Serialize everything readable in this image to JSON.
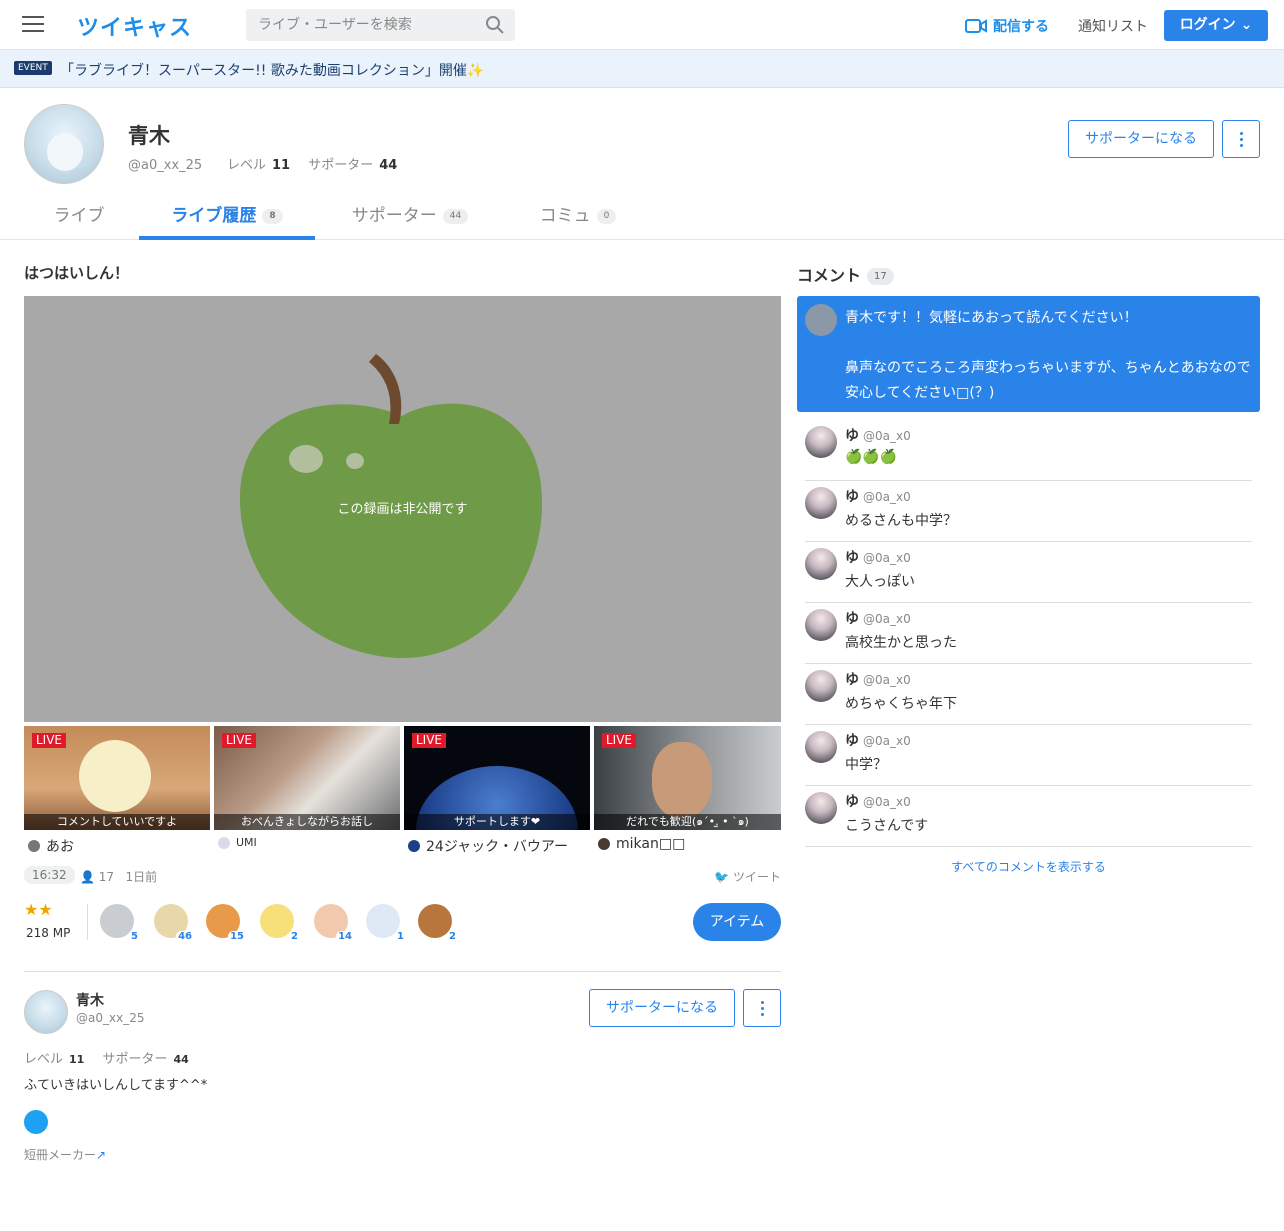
{
  "header": {
    "logo": "ツイキャス",
    "search_placeholder": "ライブ・ユーザーを検索",
    "broadcast": "配信する",
    "notifications": "通知リスト",
    "login": "ログイン"
  },
  "event": {
    "tag": "EVENT",
    "text": "「ラブライブ！スーパースター!! 歌みた動画コレクション」開催✨"
  },
  "profile": {
    "name": "青木",
    "id": "@a0_xx_25",
    "level_label": "レベル",
    "level": "11",
    "supporters_label": "サポーター",
    "supporters": "44",
    "support_button": "サポーターになる"
  },
  "tabs": [
    {
      "label": "ライブ",
      "count": ""
    },
    {
      "label": "ライブ履歴",
      "count": "8"
    },
    {
      "label": "サポーター",
      "count": "44"
    },
    {
      "label": "コミュ",
      "count": "0"
    }
  ],
  "video": {
    "title": "はつはいしん！",
    "private_msg": "この録画は非公開です",
    "duration": "16:32",
    "views": "17",
    "ago": "1日前",
    "tweet": "ツイート"
  },
  "thumbnails": [
    {
      "live": "LIVE",
      "caption": "コメントしていいですよ",
      "user": "あお"
    },
    {
      "live": "LIVE",
      "caption": "おべんきょしながらお話し",
      "user": "UMI"
    },
    {
      "live": "LIVE",
      "caption": "サポートします❤",
      "user": "24ジャック・バウアー"
    },
    {
      "live": "LIVE",
      "caption": "だれでも歓迎(๑´•.̫ • `๑)",
      "user": "mikan□□"
    }
  ],
  "items": {
    "stars": "★★",
    "mp": "218 MP",
    "gifts": [
      "5",
      "46",
      "15",
      "2",
      "14",
      "1",
      "2"
    ],
    "button": "アイテム"
  },
  "bio": {
    "name": "青木",
    "id": "@a0_xx_25",
    "level_label": "レベル",
    "level": "11",
    "supporters_label": "サポーター",
    "supporters": "44",
    "support_button": "サポーターになる",
    "description": "ふていきはいしんしてます^^*",
    "tanzaku": "短冊メーカー"
  },
  "comments": {
    "title": "コメント",
    "count": "17",
    "pinned_line1": "青木です！！気軽にあおって読んでください！",
    "pinned_line2": "鼻声なのでころころ声変わっちゃいますが、ちゃんとあおなので安心してください□(？)",
    "list": [
      {
        "name": "ゆ",
        "id": "@0a_x0",
        "text": "🍏🍏🍏"
      },
      {
        "name": "ゆ",
        "id": "@0a_x0",
        "text": "めるさんも中学？"
      },
      {
        "name": "ゆ",
        "id": "@0a_x0",
        "text": "大人っぽい"
      },
      {
        "name": "ゆ",
        "id": "@0a_x0",
        "text": "高校生かと思った"
      },
      {
        "name": "ゆ",
        "id": "@0a_x0",
        "text": "めちゃくちゃ年下"
      },
      {
        "name": "ゆ",
        "id": "@0a_x0",
        "text": "中学？"
      },
      {
        "name": "ゆ",
        "id": "@0a_x0",
        "text": "こうさんです"
      }
    ],
    "show_all": "すべてのコメントを表示する"
  }
}
